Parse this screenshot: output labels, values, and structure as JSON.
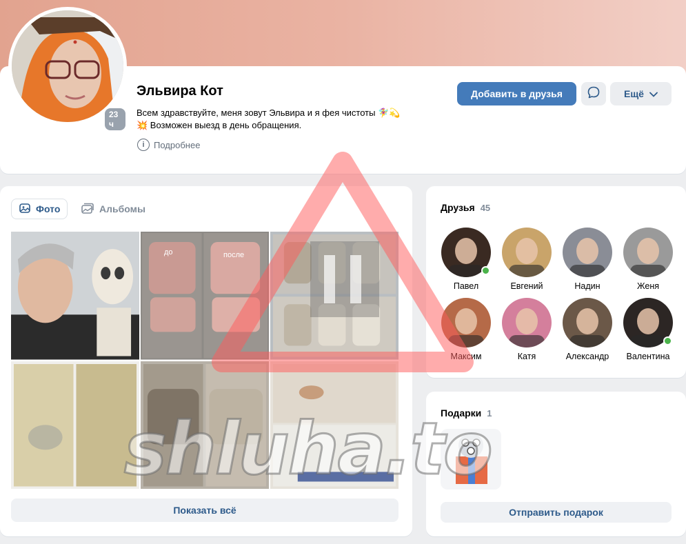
{
  "profile": {
    "name": "Эльвира Кот",
    "status_line1": "Всем здравствуйте, меня зовут Эльвира и я фея чистоты 🧚‍♀️💫",
    "status_line2": "💥 Возможен выезд в день обращения.",
    "more_info": "Подробнее",
    "last_seen": "23 ч",
    "add_friend": "Добавить в друзья",
    "more": "Ещё"
  },
  "photos": {
    "tab_photos": "Фото",
    "tab_albums": "Альбомы",
    "label_before": "до",
    "label_after": "после",
    "show_all": "Показать всё"
  },
  "friends": {
    "title": "Друзья",
    "count": "45",
    "items": [
      {
        "name": "Павел",
        "online": true,
        "color": "#3a2a22"
      },
      {
        "name": "Евгений",
        "online": false,
        "color": "#c9a46a"
      },
      {
        "name": "Надин",
        "online": false,
        "color": "#8a8d96"
      },
      {
        "name": "Женя",
        "online": false,
        "color": "#9a9a9a"
      },
      {
        "name": "Максим",
        "online": false,
        "color": "#b56a48"
      },
      {
        "name": "Катя",
        "online": false,
        "color": "#d47f9c"
      },
      {
        "name": "Александр",
        "online": false,
        "color": "#6b5848"
      },
      {
        "name": "Валентина",
        "online": true,
        "color": "#2c2624"
      }
    ]
  },
  "gifts": {
    "title": "Подарки",
    "count": "1",
    "send": "Отправить подарок"
  },
  "watermark": {
    "text": "shluha.to"
  }
}
